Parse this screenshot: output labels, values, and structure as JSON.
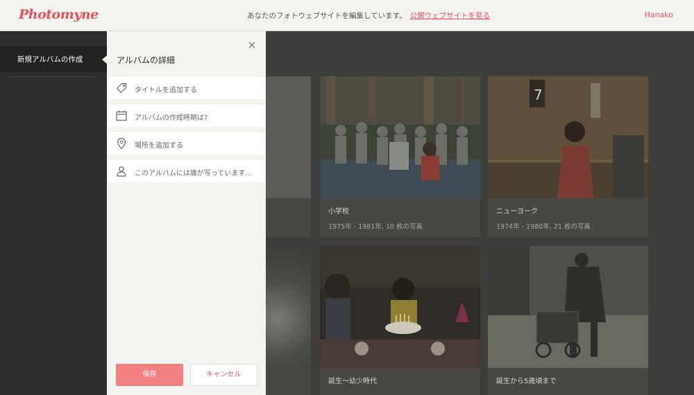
{
  "header": {
    "logo": "Photomyne",
    "notice": "あなたのフォトウェブサイトを編集しています。",
    "notice_link": "公開ウェブサイトを見る",
    "user": "Hanako"
  },
  "sidebar": {
    "items": [
      {
        "label": "新規アルバムの作成"
      }
    ]
  },
  "panel": {
    "title": "アルバムの詳細",
    "fields": [
      {
        "icon": "tag-icon",
        "placeholder": "タイトルを追加する"
      },
      {
        "icon": "calendar-icon",
        "placeholder": "アルバムの作成時期は?"
      },
      {
        "icon": "location-pin-icon",
        "placeholder": "場所を追加する"
      },
      {
        "icon": "person-icon",
        "placeholder": "このアルバムには誰が写っています..."
      }
    ],
    "save_label": "保存",
    "cancel_label": "キャンセル"
  },
  "albums": [
    {
      "title": "小学校",
      "meta": "1975年 - 1981年, 10 枚の写真"
    },
    {
      "title": "ニューヨーク",
      "meta": "1974年 - 1980年, 21 枚の写真"
    },
    {
      "title": "誕生〜幼少時代",
      "meta": ""
    },
    {
      "title": "誕生から5歳頃まで",
      "meta": ""
    }
  ],
  "colors": {
    "accent": "#e2545a",
    "save_button": "#f47f80",
    "panel_bg": "#f4f3ef",
    "sidebar_bg": "#2e2e2e"
  }
}
